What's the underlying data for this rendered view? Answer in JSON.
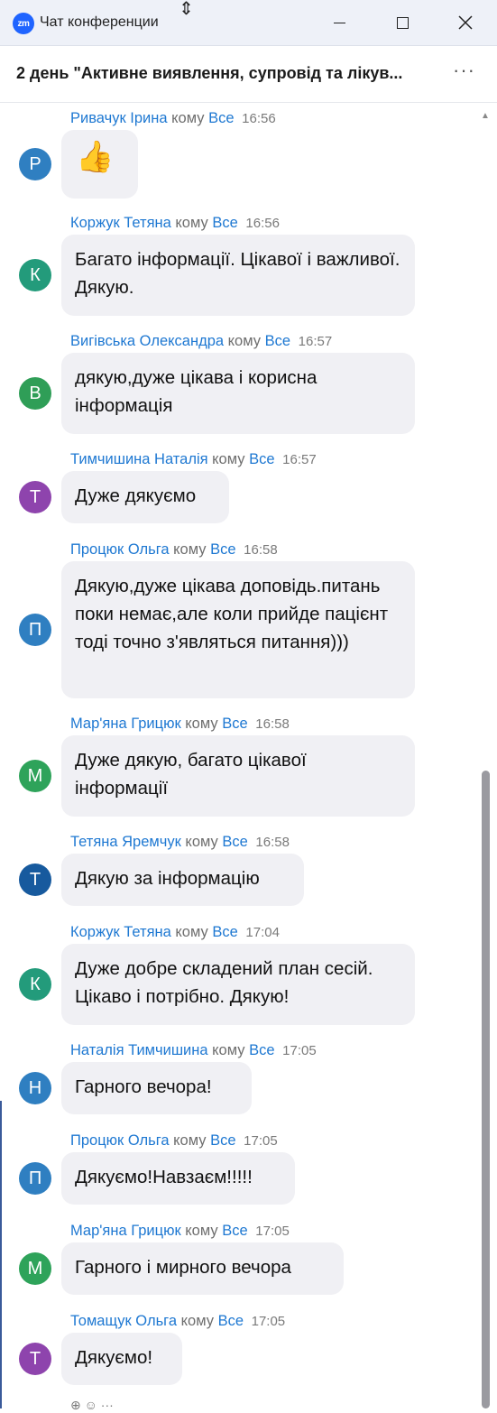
{
  "window": {
    "title": "Чат конференции",
    "logo_text": "zm",
    "cursor_glyph": "⇕"
  },
  "header": {
    "meeting_title": "2 день \"Активне виявлення, супровід та лікув...",
    "more_icon": "···"
  },
  "to_word": "кому",
  "recipient": "Все",
  "messages": [
    {
      "sender": "Ривачук Ірина",
      "time": "16:56",
      "avatar_letter": "Р",
      "avatar_color": "#2f7fc1",
      "text": "👍",
      "emoji": true
    },
    {
      "sender": "Коржук Тетяна",
      "time": "16:56",
      "avatar_letter": "К",
      "avatar_color": "#239b7b",
      "text": "Багато інформації. Цікавої і важливої. Дякую."
    },
    {
      "sender": "Вигівська Олександра",
      "time": "16:57",
      "avatar_letter": "В",
      "avatar_color": "#2f9e57",
      "text": "дякую,дуже цікава і корисна інформація"
    },
    {
      "sender": "Тимчишина Наталія",
      "time": "16:57",
      "avatar_letter": "Т",
      "avatar_color": "#8e44ad",
      "text": "Дуже дякуємо"
    },
    {
      "sender": "Процюк Ольга",
      "time": "16:58",
      "avatar_letter": "П",
      "avatar_color": "#2f7fc1",
      "text": "Дякую,дуже цікава доповідь.питань поки немає,але коли прийде пацієнт тоді точно з'являться питання)))"
    },
    {
      "sender": "Мар'яна Грицюк",
      "time": "16:58",
      "avatar_letter": "М",
      "avatar_color": "#2ea35a",
      "text": "Дуже дякую,  багато цікавої інформації"
    },
    {
      "sender": "Тетяна Яремчук",
      "time": "16:58",
      "avatar_letter": "Т",
      "avatar_color": "#175a9e",
      "text": "Дякую за інформацію"
    },
    {
      "sender": "Коржук Тетяна",
      "time": "17:04",
      "avatar_letter": "К",
      "avatar_color": "#239b7b",
      "text": "Дуже добре складений план сесій. Цікаво і потрібно. Дякую!"
    },
    {
      "sender": "Наталія Тимчишина",
      "time": "17:05",
      "avatar_letter": "Н",
      "avatar_color": "#2f7fc1",
      "text": "Гарного вечора!"
    },
    {
      "sender": "Процюк Ольга",
      "time": "17:05",
      "avatar_letter": "П",
      "avatar_color": "#2f7fc1",
      "text": "Дякуємо!Навзаєм!!!!!"
    },
    {
      "sender": "Мар'яна Грицюк",
      "time": "17:05",
      "avatar_letter": "М",
      "avatar_color": "#2ea35a",
      "text": "Гарного і мирного вечора"
    },
    {
      "sender": "Томащук Ольга",
      "time": "17:05",
      "avatar_letter": "Т",
      "avatar_color": "#8e44ad",
      "text": "Дякуємо!"
    }
  ]
}
